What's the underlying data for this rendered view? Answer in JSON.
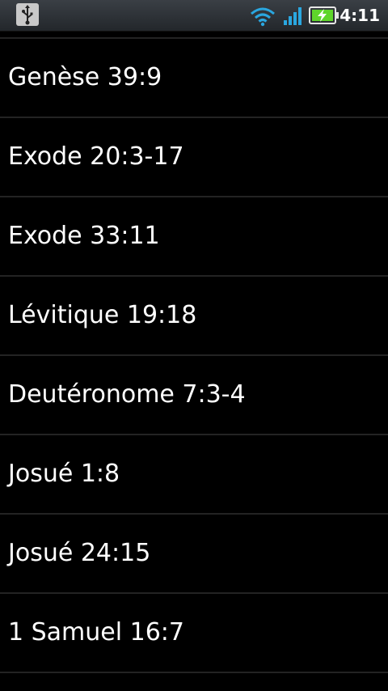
{
  "status_bar": {
    "time": "4:11",
    "icons": [
      "usb-icon",
      "wifi-icon",
      "signal-icon",
      "battery-charging-icon"
    ],
    "colors": {
      "wifi": "#2aa7e0",
      "battery": "#5fd52b"
    }
  },
  "list": {
    "items": [
      {
        "label": "Genèse 39:9"
      },
      {
        "label": "Exode 20:3-17"
      },
      {
        "label": "Exode 33:11"
      },
      {
        "label": "Lévitique 19:18"
      },
      {
        "label": "Deutéronome 7:3-4"
      },
      {
        "label": "Josué 1:8"
      },
      {
        "label": "Josué 24:15"
      },
      {
        "label": "1 Samuel 16:7"
      }
    ]
  }
}
